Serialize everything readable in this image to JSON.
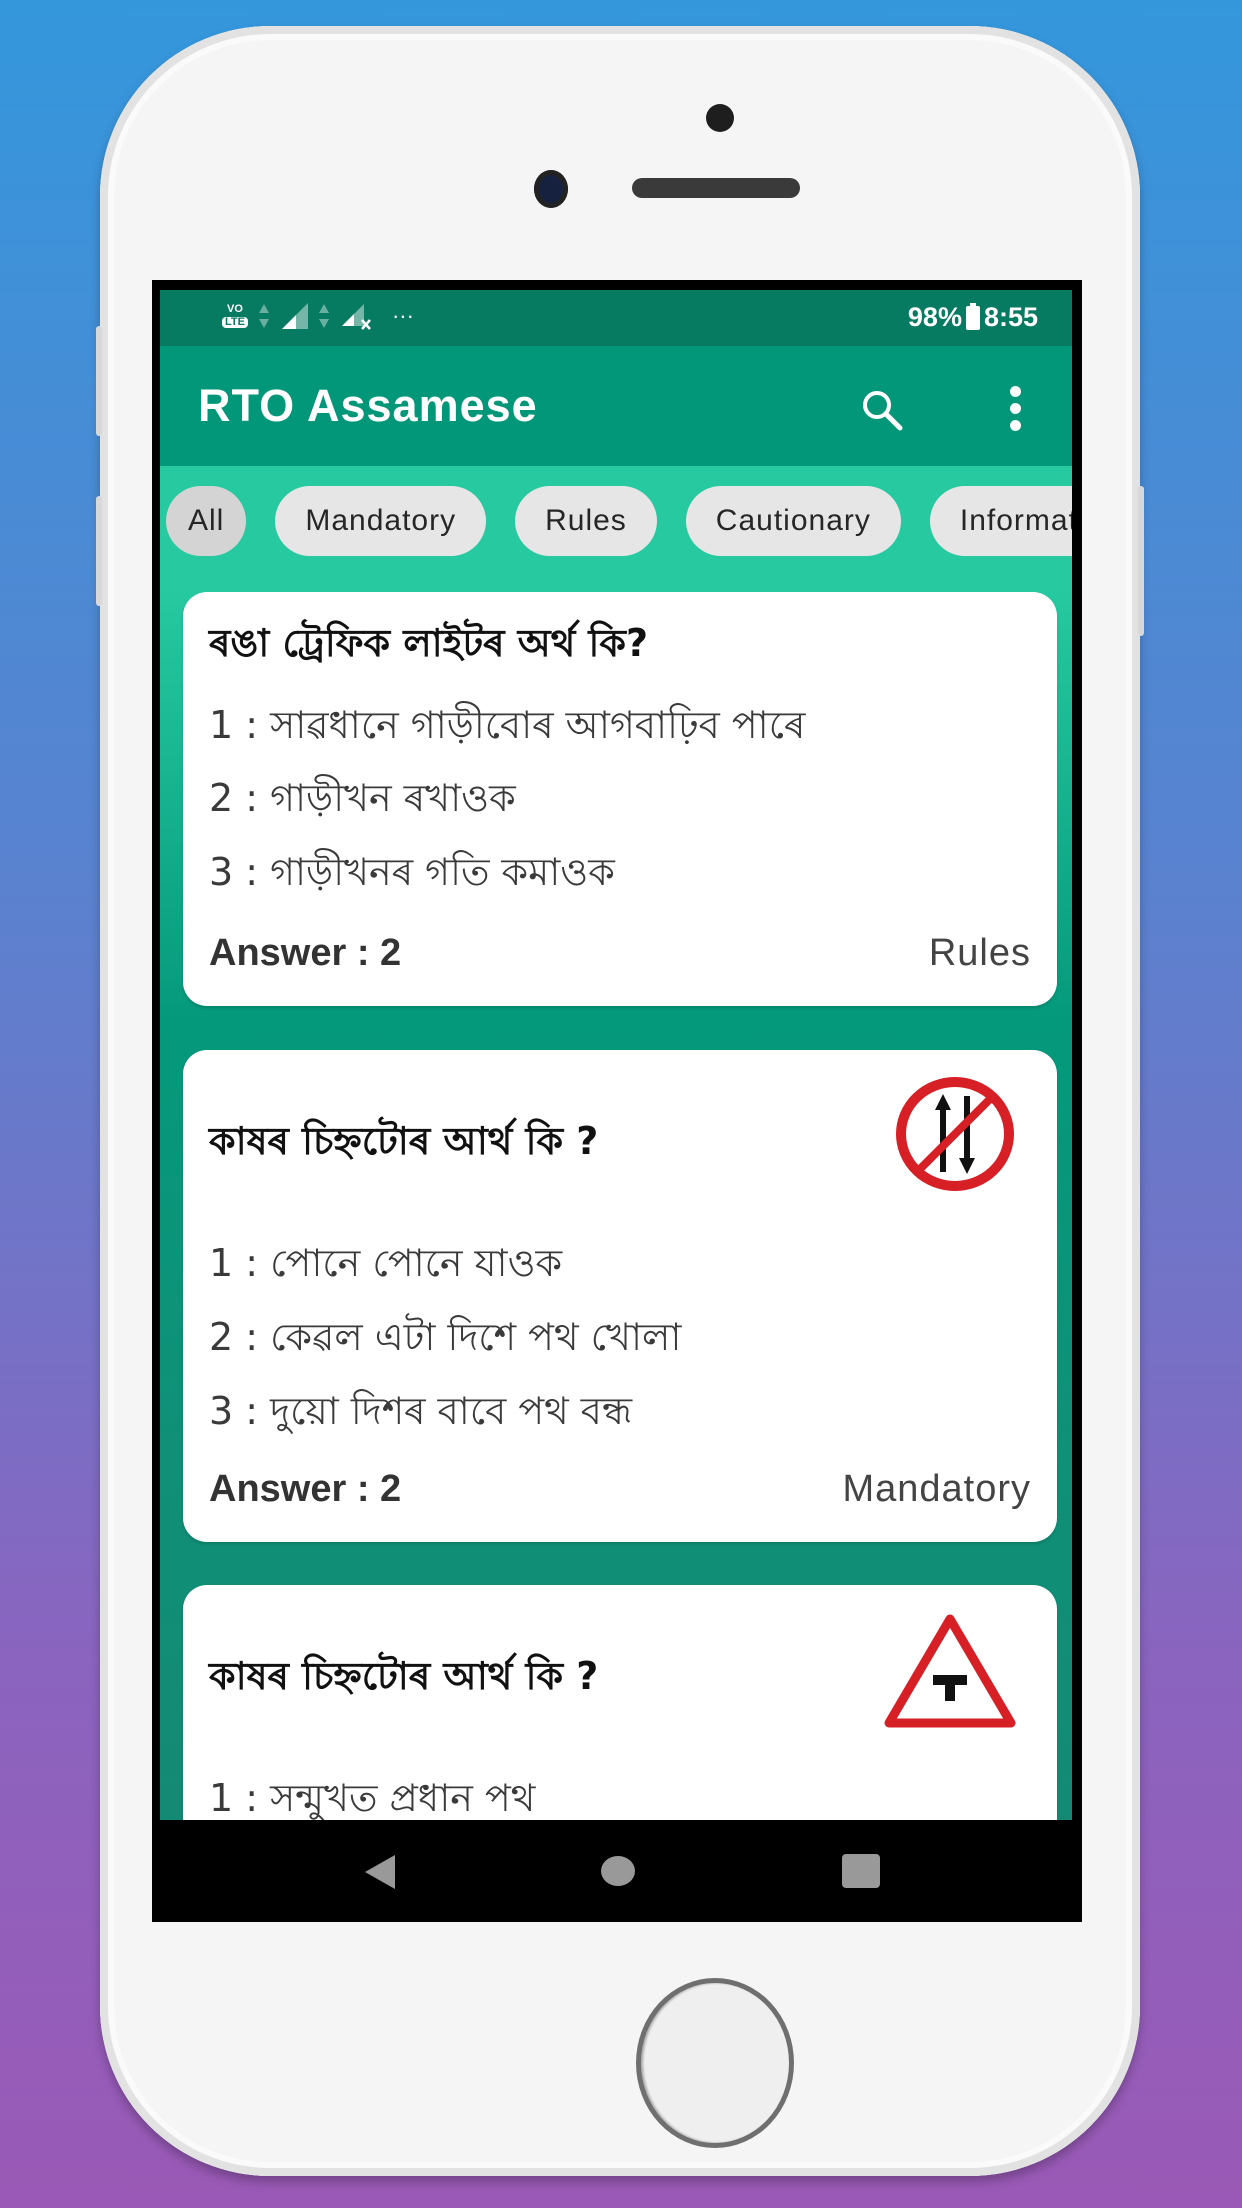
{
  "status_bar": {
    "network_label": "VO",
    "network_sub": "LTE",
    "more_indicator": "···",
    "battery_percent": "98%",
    "time": "8:55"
  },
  "app_bar": {
    "title": "RTO Assamese",
    "icons": [
      "search-icon",
      "more-vert-icon"
    ]
  },
  "filters": {
    "selected": "All",
    "chips": [
      {
        "label": "All"
      },
      {
        "label": "Mandatory"
      },
      {
        "label": "Rules"
      },
      {
        "label": "Cautionary"
      },
      {
        "label": "Informatory"
      }
    ]
  },
  "questions": [
    {
      "question": "ৰঙা ট্ৰেফিক লাইটৰ অৰ্থ কি?",
      "sign": null,
      "options": [
        "1 : সাৱধানে গাড়ীবোৰ আগবাঢ়িব পাৰে",
        "2 : গাড়ীখন ৰখাওক",
        "3 : গাড়ীখনৰ গতি কমাওক"
      ],
      "answer_label": "Answer : 2",
      "category": "Rules"
    },
    {
      "question": "কাষৰ চিহ্নটোৰ আৰ্থ কি ?",
      "sign": "no-two-way-traffic-sign-icon",
      "options": [
        "1 : পোনে পোনে যাওক",
        "2 : কেৱল এটা দিশে পথ খোলা",
        "3 : দুয়ো দিশৰ বাবে পথ বন্ধ"
      ],
      "answer_label": "Answer : 2",
      "category": "Mandatory"
    },
    {
      "question": "কাষৰ চিহ্নটোৰ আৰ্থ কি ?",
      "sign": "major-road-ahead-t-junction-sign-icon",
      "options": [
        "1 : সন্মুখত প্ৰধান পথ"
      ],
      "answer_label": "",
      "category": ""
    }
  ],
  "nav_bar": {
    "buttons": [
      "back",
      "home",
      "recents"
    ]
  },
  "colors": {
    "status_bar": "#077a62",
    "app_bar": "#03977a",
    "chip_strip": "#26c9a0",
    "chip_bg": "#e6e6e6",
    "sign_red": "#d71f26"
  }
}
